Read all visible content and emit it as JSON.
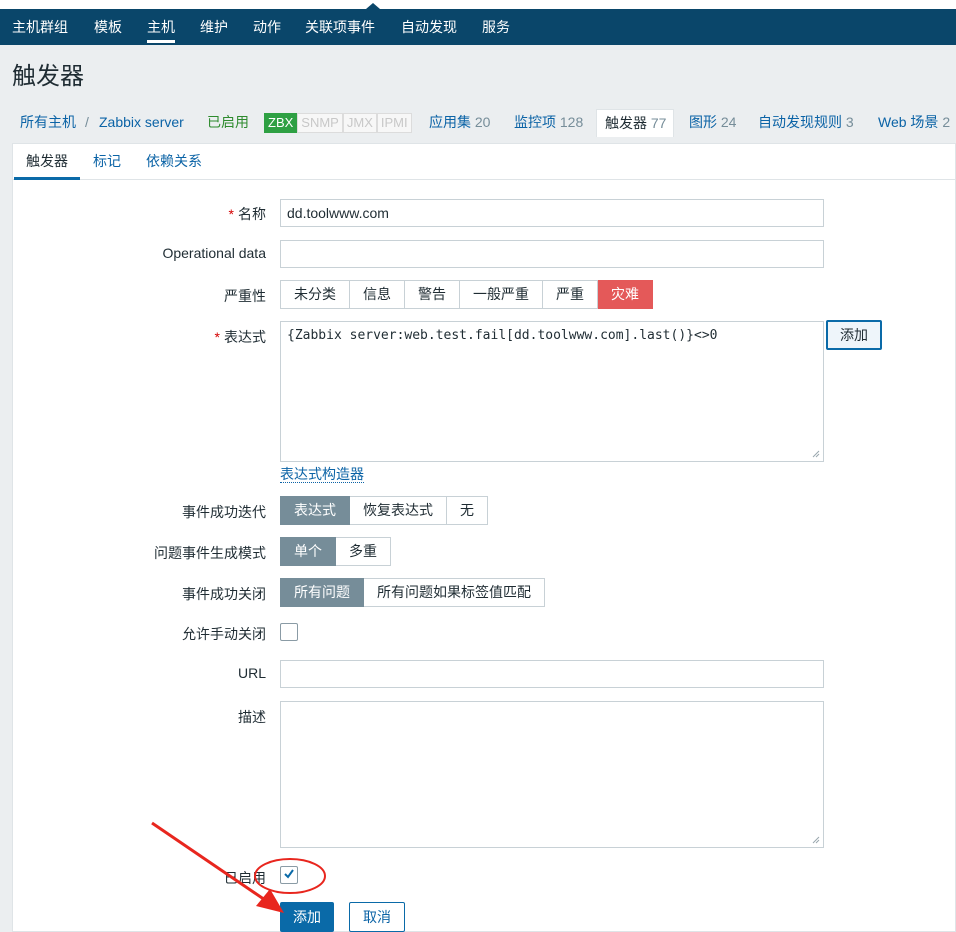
{
  "topnav": [
    "主机群组",
    "模板",
    "主机",
    "维护",
    "动作",
    "关联项事件",
    "自动发现",
    "服务"
  ],
  "page_title": "触发器",
  "hostbar": {
    "all_hosts": "所有主机",
    "separator": "/",
    "host": "Zabbix server",
    "status": "已启用",
    "badges": [
      "ZBX",
      "SNMP",
      "JMX",
      "IPMI"
    ],
    "apps_label": "应用集",
    "apps_count": "20",
    "items_label": "监控项",
    "items_count": "128",
    "triggers_label": "触发器",
    "triggers_count": "77",
    "graphs_label": "图形",
    "graphs_count": "24",
    "discovery_label": "自动发现规则",
    "discovery_count": "3",
    "web_label": "Web 场景",
    "web_count": "2"
  },
  "tabs": [
    "触发器",
    "标记",
    "依赖关系"
  ],
  "form": {
    "name_label": "名称",
    "name_value": "dd.toolwww.com",
    "opdata_label": "Operational data",
    "opdata_value": "",
    "severity_label": "严重性",
    "severity_options": [
      "未分类",
      "信息",
      "警告",
      "一般严重",
      "严重",
      "灾难"
    ],
    "severity_selected": "灾难",
    "expression_label": "表达式",
    "expression_value": "{Zabbix server:web.test.fail[dd.toolwww.com].last()}<>0",
    "add_button": "添加",
    "expression_builder": "表达式构造器",
    "ok_event_label": "事件成功迭代",
    "ok_event_options": [
      "表达式",
      "恢复表达式",
      "无"
    ],
    "problem_mode_label": "问题事件生成模式",
    "problem_mode_options": [
      "单个",
      "多重"
    ],
    "ok_close_label": "事件成功关闭",
    "ok_close_options": [
      "所有问题",
      "所有问题如果标签值匹配"
    ],
    "manual_close_label": "允许手动关闭",
    "manual_close_checked": false,
    "url_label": "URL",
    "url_value": "",
    "description_label": "描述",
    "description_value": "",
    "enabled_label": "已启用",
    "enabled_checked": true,
    "submit_button": "添加",
    "cancel_button": "取消"
  },
  "colors": {
    "nav_bg": "#0a466a",
    "link": "#0b63a6",
    "selected_segment": "#768d99",
    "disaster": "#e45959",
    "zbx_badge": "#2ea043",
    "annotation_red": "#e8261e"
  }
}
